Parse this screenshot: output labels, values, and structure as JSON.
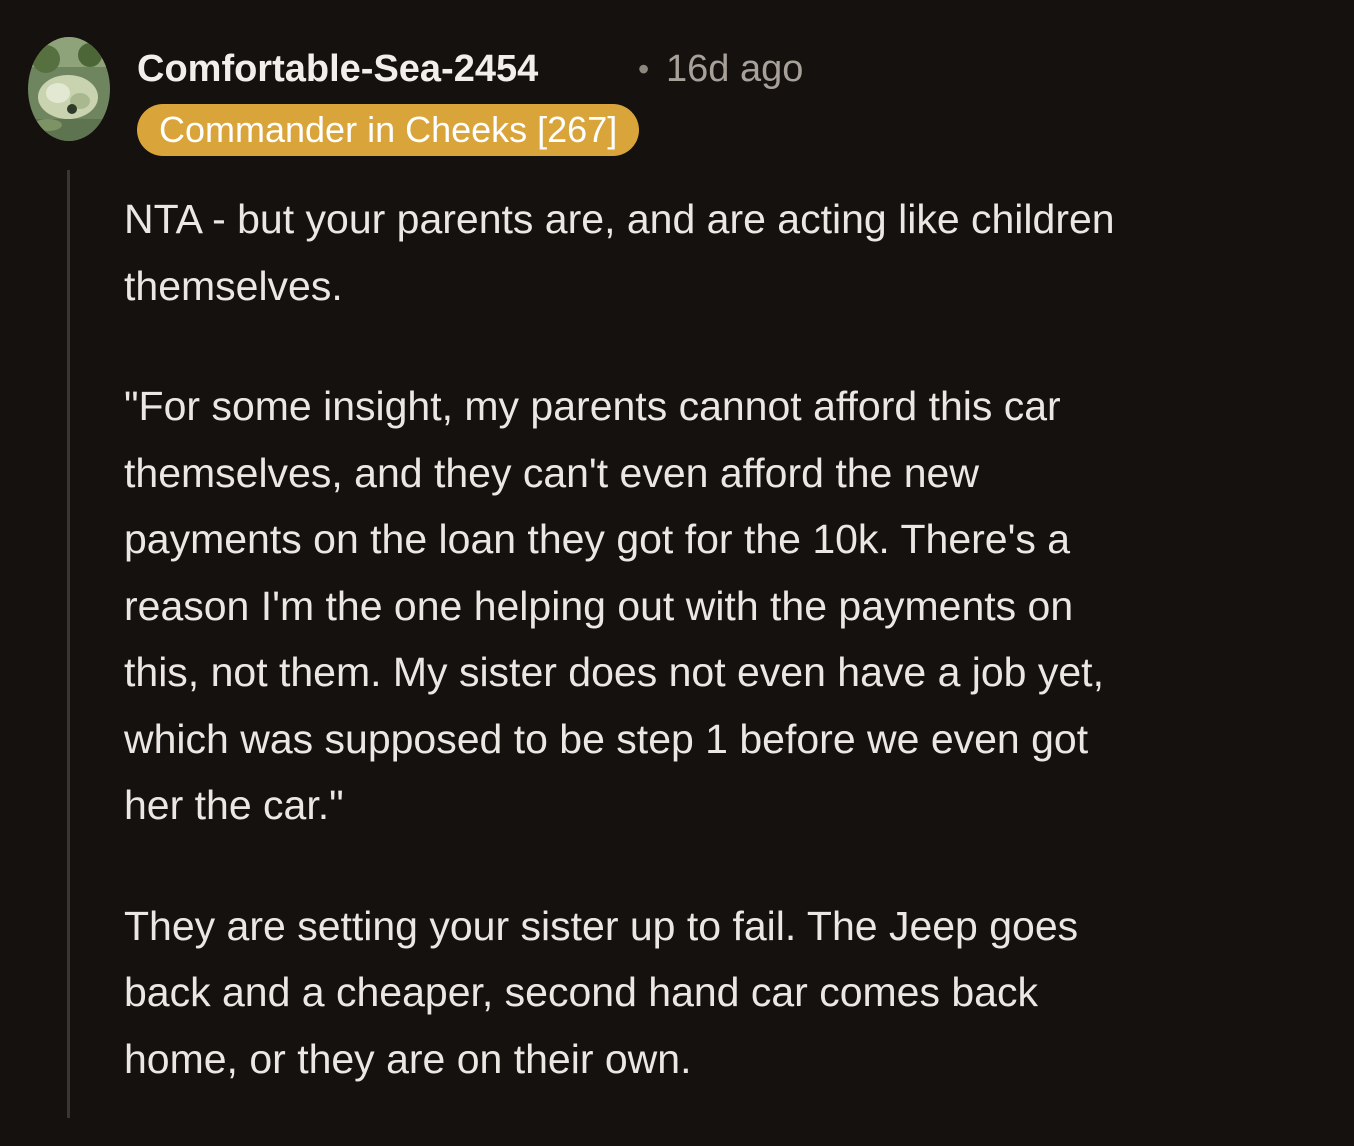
{
  "comment": {
    "author": "Comfortable-Sea-2454",
    "separator": "•",
    "timestamp": "16d ago",
    "flair": "Commander in Cheeks [267]",
    "paragraphs": [
      "NTA - but your parents are, and are acting like children\nthemselves.",
      "\"For some insight, my parents cannot afford this car\nthemselves, and they can't even afford the new\npayments on the loan they got for the 10k. There's a\nreason I'm the one helping out with the payments on\nthis, not them. My sister does not even have a job yet,\nwhich was supposed to be step 1 before we even got\nher the car.\"",
      "They are setting your sister up to fail. The Jeep goes\nback and a cheaper, second hand car comes back\nhome, or they are on their own."
    ]
  },
  "colors": {
    "background": "#14110f",
    "flair_bg": "#d9a43a",
    "text": "#ebe8e4",
    "muted": "#a8a19a"
  }
}
